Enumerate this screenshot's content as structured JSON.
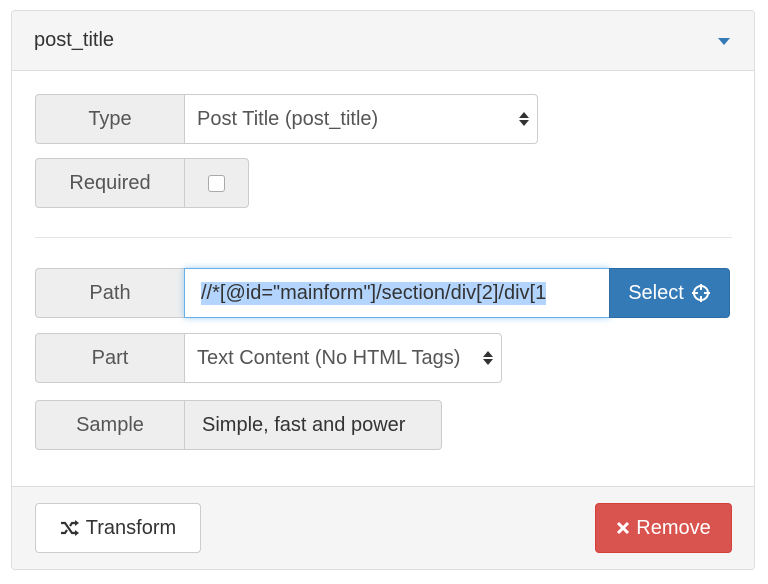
{
  "panel": {
    "title": "post_title"
  },
  "fields": {
    "type": {
      "label": "Type",
      "value": "Post Title (post_title)"
    },
    "required": {
      "label": "Required",
      "checked": false
    },
    "path": {
      "label": "Path",
      "value": "//*[@id=\"mainform\"]/section/div[2]/div[1",
      "select_label": "Select"
    },
    "part": {
      "label": "Part",
      "value": "Text Content (No HTML Tags)"
    },
    "sample": {
      "label": "Sample",
      "value": "Simple, fast and power"
    }
  },
  "footer": {
    "transform_label": "Transform",
    "remove_label": "Remove"
  },
  "icons": {
    "collapse": "caret-down-icon",
    "select": "crosshairs-icon",
    "transform": "random-icon",
    "remove": "times-icon"
  },
  "colors": {
    "primary": "#337ab7",
    "danger": "#d9534f",
    "selection": "#b3d4fc"
  }
}
